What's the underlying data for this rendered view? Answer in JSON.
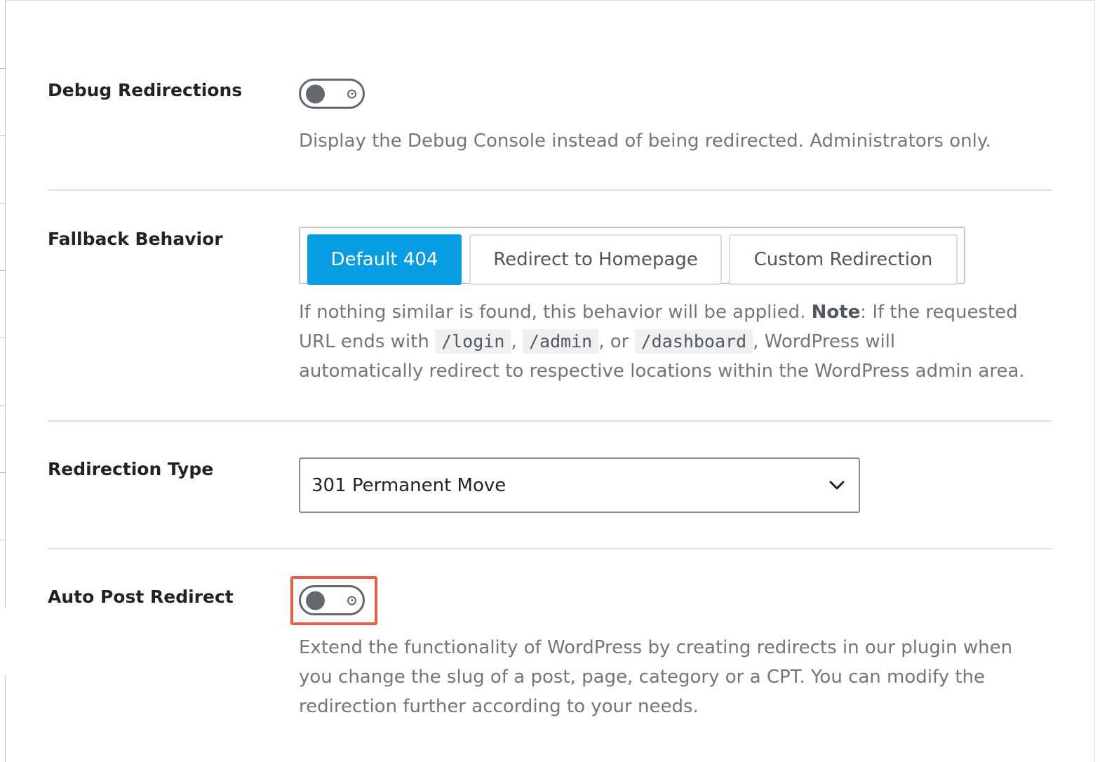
{
  "settings": {
    "debug_redirections": {
      "label": "Debug Redirections",
      "enabled": false,
      "description": "Display the Debug Console instead of being redirected. Administrators only."
    },
    "fallback_behavior": {
      "label": "Fallback Behavior",
      "options": [
        "Default 404",
        "Redirect to Homepage",
        "Custom Redirection"
      ],
      "selected": "Default 404",
      "description": {
        "line1_prefix": "If nothing similar is found, this behavior will be applied. ",
        "note_label": "Note",
        "line1_suffix": ": If the requested",
        "line2_prefix": "URL ends with ",
        "code_login": "/login",
        "sep1": ",",
        "code_admin": "/admin",
        "sep2": ", or",
        "code_dashboard": "/dashboard",
        "line2_suffix": ", WordPress will",
        "line3": "automatically redirect to respective locations within the WordPress admin area."
      }
    },
    "redirection_type": {
      "label": "Redirection Type",
      "selected_value": "301 Permanent Move"
    },
    "auto_post_redirect": {
      "label": "Auto Post Redirect",
      "enabled": false,
      "highlight_color": "#ea5e47",
      "description_lines": [
        "Extend the functionality of WordPress by creating redirects in our plugin when",
        "you change the slug of a post, page, category or a CPT. You can modify the",
        "redirection further according to your needs."
      ]
    }
  },
  "colors": {
    "accent": "#069de3",
    "toggle_gray": "#646970",
    "description_text": "#757575"
  },
  "icons": {
    "select_arrow": "chevron-down-icon"
  }
}
